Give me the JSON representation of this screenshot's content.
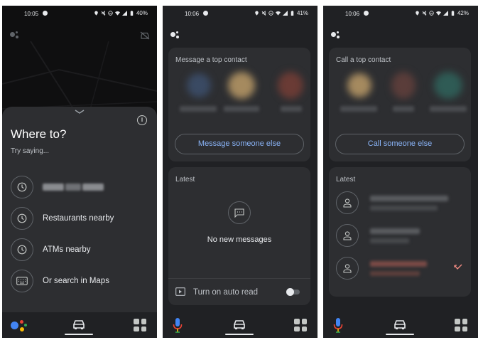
{
  "screens": [
    {
      "status": {
        "time": "10:05",
        "battery": "40%"
      },
      "sheet": {
        "title": "Where to?",
        "subtitle": "Try saying...",
        "suggestions": [
          {
            "label": "",
            "icon": "clock-icon"
          },
          {
            "label": "Restaurants nearby",
            "icon": "clock-icon"
          },
          {
            "label": "ATMs nearby",
            "icon": "clock-icon"
          },
          {
            "label": "Or search in Maps",
            "icon": "keyboard-icon"
          }
        ]
      }
    },
    {
      "status": {
        "time": "10:06",
        "battery": "41%"
      },
      "top_card": {
        "title": "Message a top contact",
        "action": "Message someone else"
      },
      "latest": {
        "title": "Latest",
        "empty": "No new messages"
      },
      "auto_read": {
        "label": "Turn on auto read"
      }
    },
    {
      "status": {
        "time": "10:06",
        "battery": "42%"
      },
      "top_card": {
        "title": "Call a top contact",
        "action": "Call someone else"
      },
      "latest": {
        "title": "Latest"
      }
    }
  ],
  "colors": {
    "background": "#202124",
    "card": "#2d2e31",
    "accent_link": "#8ab4f8",
    "missed_call": "#f28b82"
  }
}
